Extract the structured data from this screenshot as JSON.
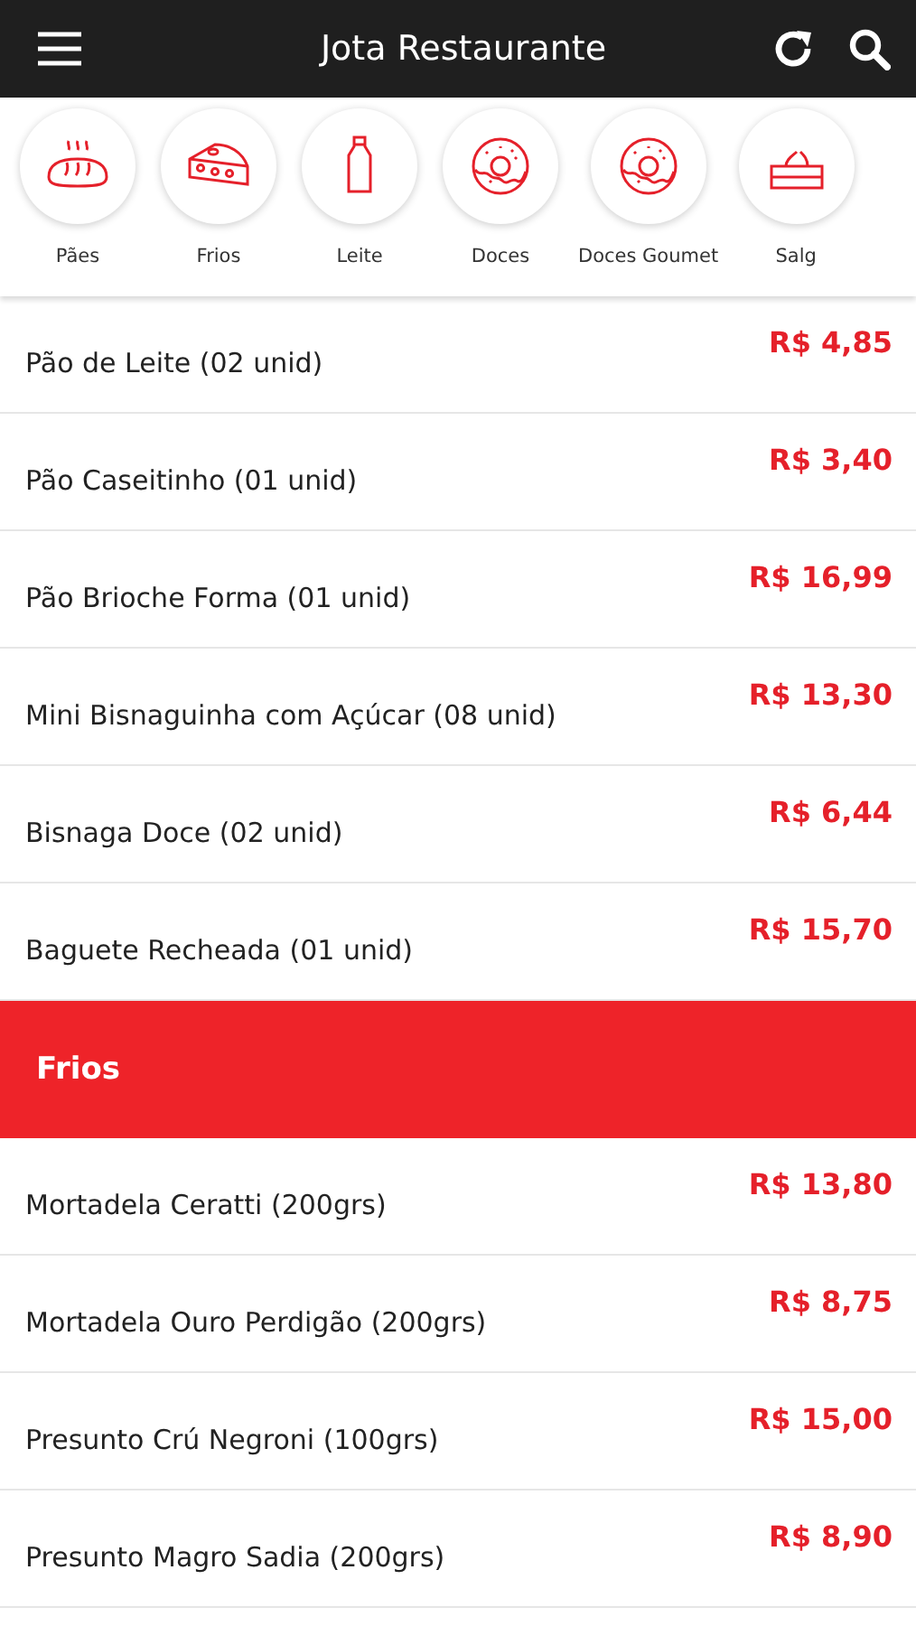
{
  "header": {
    "title": "Jota Restaurante"
  },
  "categories": [
    {
      "label": "Pães",
      "kind": "bread"
    },
    {
      "label": "Frios",
      "kind": "cheese"
    },
    {
      "label": "Leite",
      "kind": "bottle"
    },
    {
      "label": "Doces",
      "kind": "donut"
    },
    {
      "label": "Doces Goumet",
      "kind": "donut"
    },
    {
      "label": "Salg",
      "kind": "cake"
    }
  ],
  "items": [
    {
      "kind": "product",
      "name": "Pão de Leite (02 unid)",
      "price": "R$ 4,85"
    },
    {
      "kind": "product",
      "name": "Pão Caseitinho (01 unid)",
      "price": "R$ 3,40"
    },
    {
      "kind": "product",
      "name": "Pão Brioche Forma (01 unid)",
      "price": "R$ 16,99"
    },
    {
      "kind": "product",
      "name": "Mini Bisnaguinha com Açúcar (08 unid)",
      "price": "R$ 13,30"
    },
    {
      "kind": "product",
      "name": "Bisnaga Doce (02 unid)",
      "price": "R$ 6,44"
    },
    {
      "kind": "product",
      "name": "Baguete Recheada (01 unid)",
      "price": "R$ 15,70"
    },
    {
      "kind": "section",
      "name": "Frios"
    },
    {
      "kind": "product",
      "name": "Mortadela Ceratti (200grs)",
      "price": "R$ 13,80"
    },
    {
      "kind": "product",
      "name": "Mortadela Ouro Perdigão (200grs)",
      "price": "R$ 8,75"
    },
    {
      "kind": "product",
      "name": "Presunto Crú Negroni (100grs)",
      "price": "R$ 15,00"
    },
    {
      "kind": "product",
      "name": "Presunto Magro Sadia (200grs)",
      "price": "R$ 8,90"
    }
  ]
}
